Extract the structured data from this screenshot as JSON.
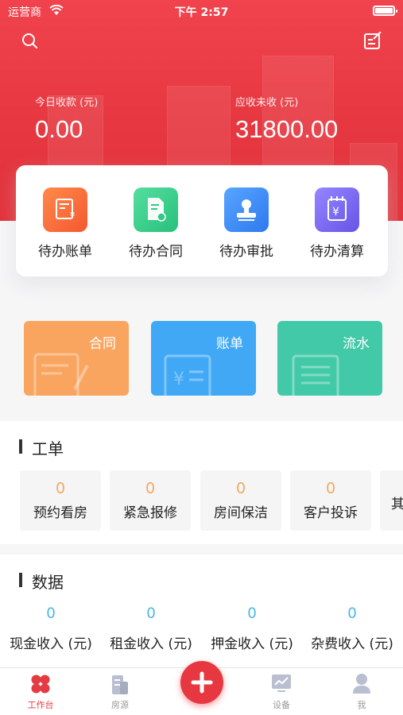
{
  "status_bar": {
    "carrier": "运营商",
    "time": "下午 2:57"
  },
  "header": {
    "today_received_label": "今日收款 (元)",
    "today_received_value": "0.00",
    "receivable_label": "应收未收 (元)",
    "receivable_value": "31800.00"
  },
  "quick_actions": [
    {
      "label": "待办账单",
      "icon": "bill-icon",
      "color": "#f7743d"
    },
    {
      "label": "待办合同",
      "icon": "contract-icon",
      "color": "#3ccf8e"
    },
    {
      "label": "待办审批",
      "icon": "stamp-icon",
      "color": "#3d8ef7"
    },
    {
      "label": "待办清算",
      "icon": "settlement-icon",
      "color": "#7b6cf0"
    }
  ],
  "feature_cards": [
    {
      "label": "合同",
      "color": "#f9a560"
    },
    {
      "label": "账单",
      "color": "#40a8f5"
    },
    {
      "label": "流水",
      "color": "#42c9a8"
    }
  ],
  "work_orders": {
    "title": "工单",
    "items": [
      {
        "count": "0",
        "label": "预约看房"
      },
      {
        "count": "0",
        "label": "紧急报修"
      },
      {
        "count": "0",
        "label": "房间保洁"
      },
      {
        "count": "0",
        "label": "客户投诉"
      },
      {
        "count": "",
        "label": "其"
      }
    ]
  },
  "data_section": {
    "title": "数据",
    "items": [
      {
        "value": "0",
        "label": "现金收入 (元)"
      },
      {
        "value": "0",
        "label": "租金收入 (元)"
      },
      {
        "value": "0",
        "label": "押金收入 (元)"
      },
      {
        "value": "0",
        "label": "杂费收入 (元)"
      }
    ]
  },
  "tabbar": {
    "items": [
      {
        "label": "工作台",
        "icon": "workbench-icon",
        "active": true
      },
      {
        "label": "房源",
        "icon": "house-source-icon",
        "active": false
      },
      {
        "label": "设备",
        "icon": "device-icon",
        "active": false
      },
      {
        "label": "我",
        "icon": "profile-icon",
        "active": false
      }
    ],
    "fab_icon": "plus-icon"
  },
  "colors": {
    "brand": "#e73841",
    "count_orange": "#f5a65b",
    "data_blue": "#3fb4e8"
  }
}
